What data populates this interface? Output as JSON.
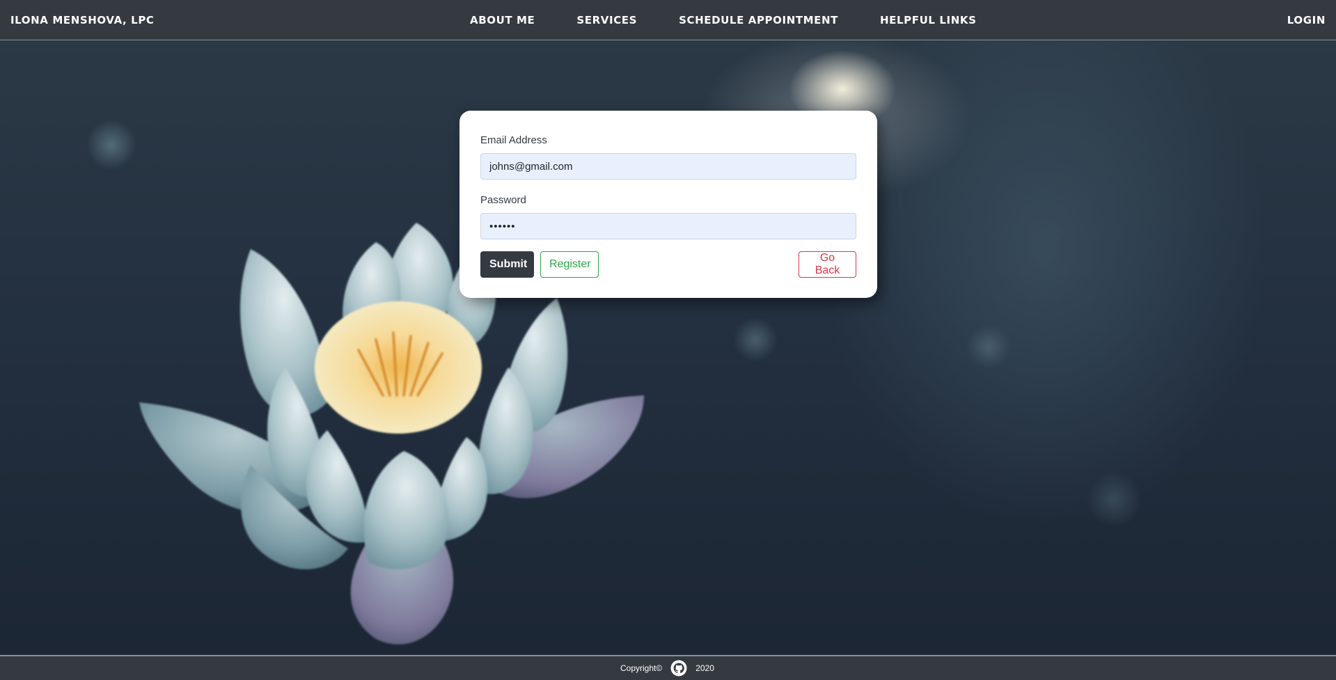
{
  "navbar": {
    "brand": "ILONA MENSHOVA, LPC",
    "links": [
      {
        "label": "ABOUT ME"
      },
      {
        "label": "SERVICES"
      },
      {
        "label": "SCHEDULE APPOINTMENT"
      },
      {
        "label": "HELPFUL LINKS"
      }
    ],
    "login": "LOGIN"
  },
  "login_form": {
    "email_label": "Email Address",
    "email_value": "johns@gmail.com",
    "password_label": "Password",
    "password_value": "••••••",
    "submit_label": "Submit",
    "register_label": "Register",
    "back_label": "Go Back"
  },
  "footer": {
    "copyright": "Copyright©",
    "icon": "github-icon",
    "year": "2020"
  },
  "colors": {
    "navbar": "#343a40",
    "submit": "#343a40",
    "register": "#28a745",
    "back": "#dc3545",
    "input_bg": "#e8f0fe"
  }
}
